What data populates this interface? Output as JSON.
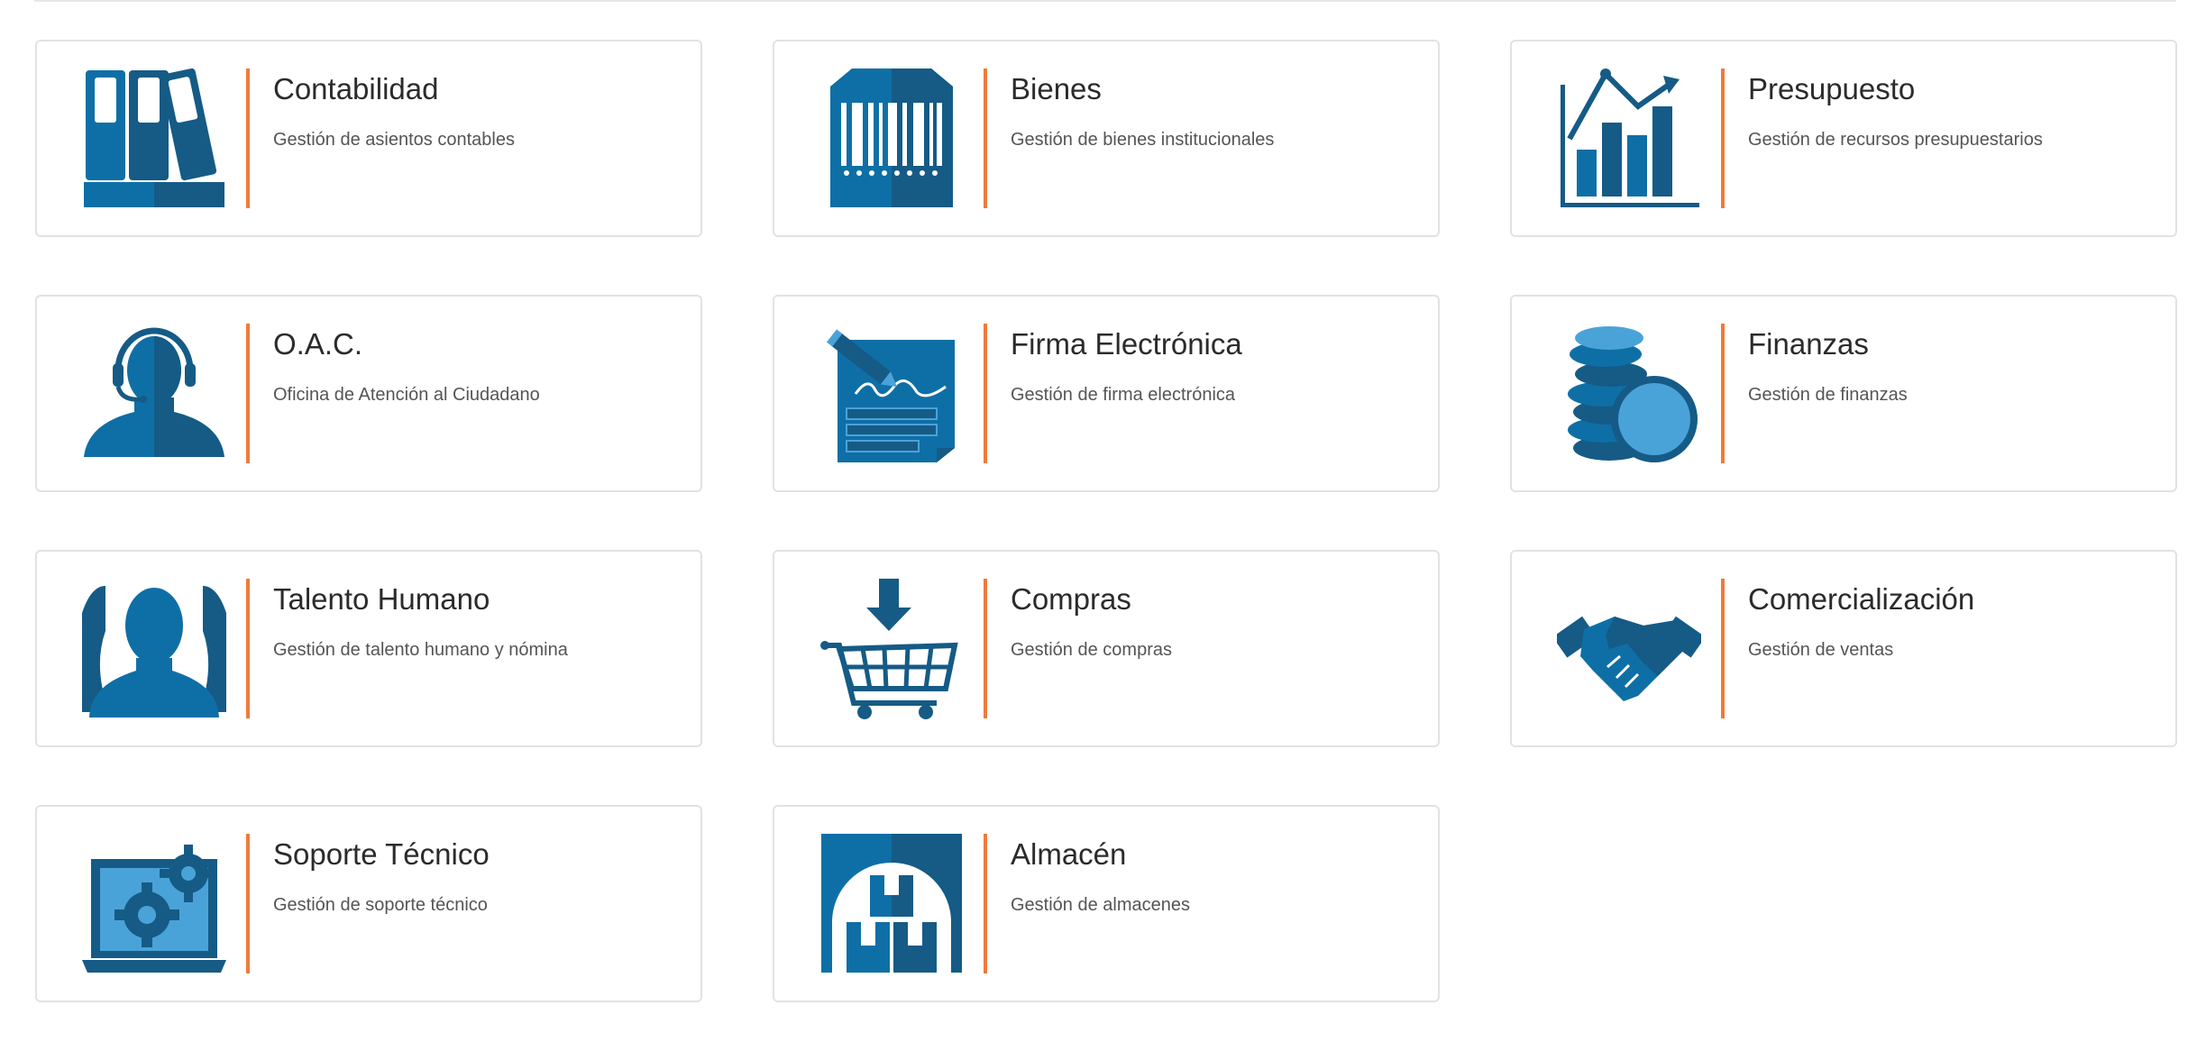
{
  "modules": [
    {
      "title": "Contabilidad",
      "desc": "Gestión de asientos contables",
      "icon": "ledger-books-icon"
    },
    {
      "title": "Bienes",
      "desc": "Gestión de bienes institucionales",
      "icon": "barcode-icon"
    },
    {
      "title": "Presupuesto",
      "desc": "Gestión de recursos presupuestarios",
      "icon": "bar-chart-icon"
    },
    {
      "title": "O.A.C.",
      "desc": "Oficina de Atención al Ciudadano",
      "icon": "headset-agent-icon"
    },
    {
      "title": "Firma Electrónica",
      "desc": "Gestión de firma electrónica",
      "icon": "signature-document-icon"
    },
    {
      "title": "Finanzas",
      "desc": "Gestión de finanzas",
      "icon": "coins-icon"
    },
    {
      "title": "Talento Humano",
      "desc": "Gestión de talento humano y nómina",
      "icon": "people-icon"
    },
    {
      "title": "Compras",
      "desc": "Gestión de compras",
      "icon": "shopping-cart-icon"
    },
    {
      "title": "Comercialización",
      "desc": "Gestión de ventas",
      "icon": "handshake-icon"
    },
    {
      "title": "Soporte Técnico",
      "desc": "Gestión de soporte técnico",
      "icon": "laptop-gears-icon"
    },
    {
      "title": "Almacén",
      "desc": "Gestión de almacenes",
      "icon": "warehouse-boxes-icon"
    }
  ],
  "colors": {
    "primary": "#0e6fa6",
    "dark": "#155b86",
    "light": "#4aa3d8",
    "accent": "#f07a3a",
    "border": "#e2e2e2"
  }
}
